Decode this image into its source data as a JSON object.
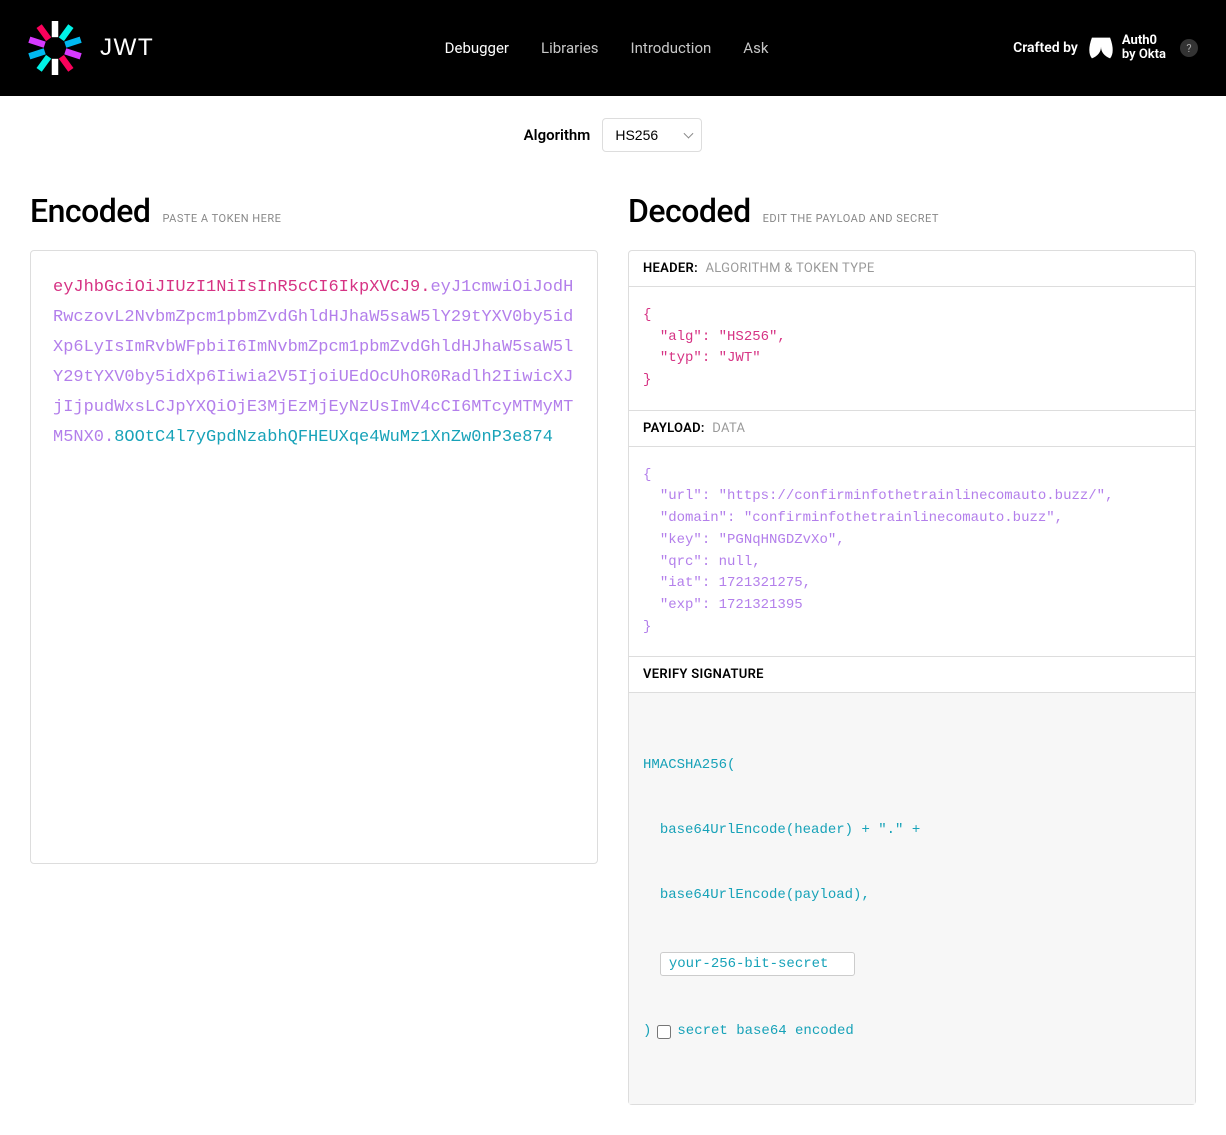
{
  "nav": {
    "items": [
      {
        "label": "Debugger",
        "active": true
      },
      {
        "label": "Libraries",
        "active": false
      },
      {
        "label": "Introduction",
        "active": false
      },
      {
        "label": "Ask",
        "active": false
      }
    ],
    "crafted": "Crafted by",
    "auth0_line1": "Auth0",
    "auth0_line2": "by Okta",
    "help": "?"
  },
  "algo": {
    "label": "Algorithm",
    "value": "HS256"
  },
  "encoded": {
    "title": "Encoded",
    "hint": "PASTE A TOKEN HERE",
    "header": "eyJhbGciOiJIUzI1NiIsInR5cCI6IkpXVCJ9",
    "payload": "eyJ1cmwiOiJodHRwczovL2NvbmZpcm1pbmZvdGhldHJhaW5saW5lY29tYXV0by5idXp6LyIsImRvbWFpbiI6ImNvbmZpcm1pbmZvdGhldHJhaW5saW5lY29tYXV0by5idXp6Iiwia2V5IjoiUEdOcUhOR0Radlh2IiwicXJjIjpudWxsLCJpYXQiOjE3MjEzMjEyNzUsImV4cCI6MTcyMTMyMTM5NX0",
    "signature": "8OOtC4l7yGpdNzabhQFHEUXqe4WuMz1XnZw0nP3e874"
  },
  "decoded": {
    "title": "Decoded",
    "hint": "EDIT THE PAYLOAD AND SECRET",
    "header_section": {
      "label": "HEADER:",
      "sub": "ALGORITHM & TOKEN TYPE",
      "json": "{\n  \"alg\": \"HS256\",\n  \"typ\": \"JWT\"\n}"
    },
    "payload_section": {
      "label": "PAYLOAD:",
      "sub": "DATA",
      "json": "{\n  \"url\": \"https://confirminfothetrainlinecomauto.buzz/\",\n  \"domain\": \"confirminfothetrainlinecomauto.buzz\",\n  \"key\": \"PGNqHNGDZvXo\",\n  \"qrc\": null,\n  \"iat\": 1721321275,\n  \"exp\": 1721321395\n}"
    },
    "signature_section": {
      "label": "VERIFY SIGNATURE",
      "line1": "HMACSHA256(",
      "line2": "  base64UrlEncode(header) + \".\" +",
      "line3": "  base64UrlEncode(payload),",
      "secret_placeholder": "your-256-bit-secret",
      "closing": ")",
      "checkbox_label": "secret base64 encoded"
    }
  }
}
